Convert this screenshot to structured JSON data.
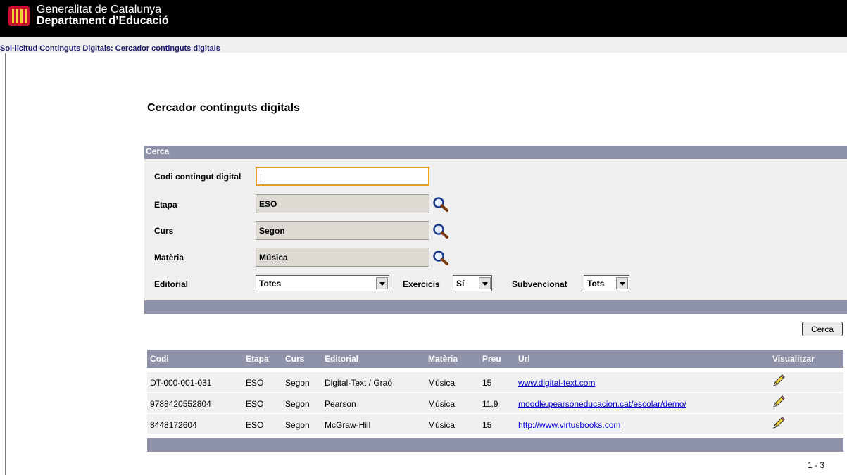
{
  "header": {
    "line1": "Generalitat de Catalunya",
    "line2": "Departament d’Educació"
  },
  "breadcrumb": "Sol·licitud Continguts Digitals: Cercador continguts digitals",
  "page_title": "Cercador continguts digitals",
  "search": {
    "section_label": "Cerca",
    "code_label": "Codi contingut digital",
    "code_value": "",
    "stage_label": "Etapa",
    "stage_value": "ESO",
    "course_label": "Curs",
    "course_value": "Segon",
    "subject_label": "Matèria",
    "subject_value": "Música",
    "publisher_label": "Editorial",
    "publisher_value": "Totes",
    "exercises_label": "Exercicis",
    "exercises_value": "Sí",
    "subsidized_label": "Subvencionat",
    "subsidized_value": "Tots",
    "button_label": "Cerca"
  },
  "table": {
    "headers": {
      "code": "Codi",
      "stage": "Etapa",
      "course": "Curs",
      "publisher": "Editorial",
      "subject": "Matèria",
      "price": "Preu",
      "url": "Url",
      "view": "Visualitzar"
    },
    "rows": [
      {
        "code": "DT-000-001-031",
        "stage": "ESO",
        "course": "Segon",
        "publisher": "Digital-Text / Graó",
        "subject": "Música",
        "price": "15",
        "url": "www.digital-text.com"
      },
      {
        "code": "9788420552804",
        "stage": "ESO",
        "course": "Segon",
        "publisher": "Pearson",
        "subject": "Música",
        "price": "11,9",
        "url": "moodle.pearsoneducacion.cat/escolar/demo/"
      },
      {
        "code": "8448172604",
        "stage": "ESO",
        "course": "Segon",
        "publisher": "McGraw-Hill",
        "subject": "Música",
        "price": "15",
        "url": "http://www.virtusbooks.com"
      }
    ]
  },
  "pagination": "1 - 3",
  "icons": {
    "search": "magnifier-icon",
    "view": "pencil-icon",
    "logo": "catalan-flag-logo"
  },
  "colors": {
    "header_bg": "#000000",
    "bar": "#8f93a9",
    "panel": "#efefef",
    "focus": "#e3a12a",
    "link": "#0000cc"
  }
}
